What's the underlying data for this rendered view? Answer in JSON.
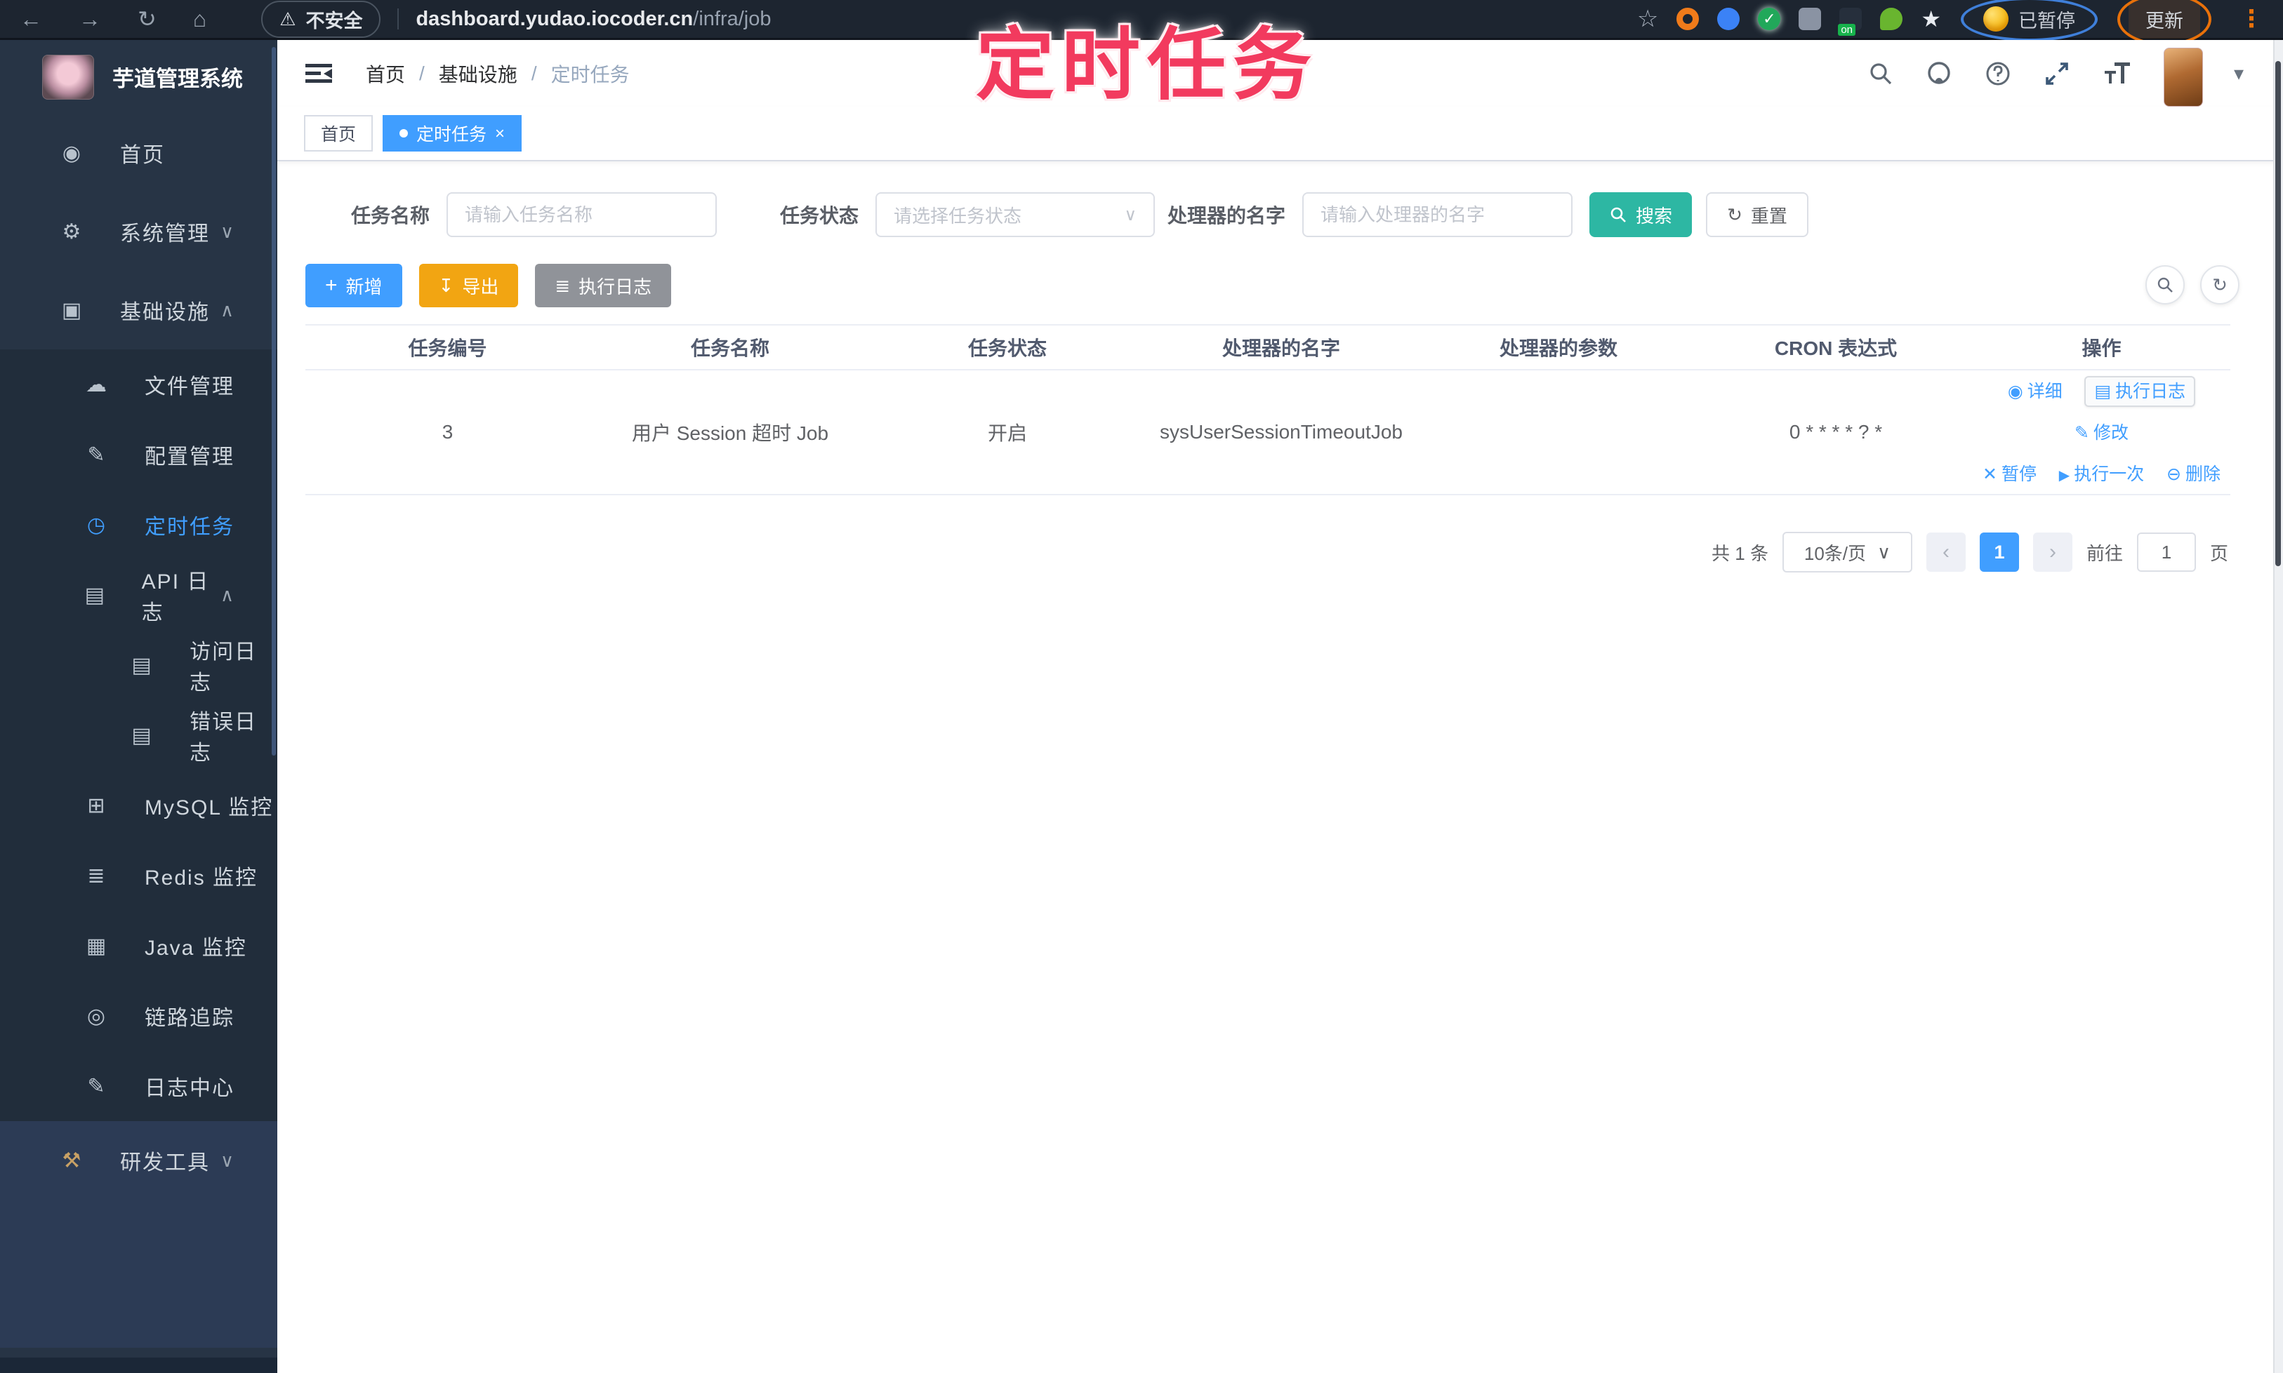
{
  "colors": {
    "accent": "#409EFF",
    "search_teal": "#2db7a3",
    "export_orange": "#f2a512",
    "info_gray": "#909399",
    "overlay_pink": "#f23a5e",
    "sidebar_bg": "#273445"
  },
  "overlay_title": "定时任务",
  "browser": {
    "security_label": "不安全",
    "url_host": "dashboard.yudao.iocoder.cn",
    "url_path": "/infra/job",
    "paused_badge": "已暂停",
    "update_label": "更新"
  },
  "sidebar": {
    "logo_title": "芋道管理系统",
    "items": [
      {
        "label": "首页",
        "icon": "dashboard-icon"
      },
      {
        "label": "系统管理",
        "icon": "gear-icon"
      },
      {
        "label": "基础设施",
        "icon": "monitor-icon"
      },
      {
        "label": "文件管理",
        "icon": "cloud-upload-icon"
      },
      {
        "label": "配置管理",
        "icon": "edit-square-icon"
      },
      {
        "label": "定时任务",
        "icon": "timer-icon"
      },
      {
        "label": "API 日志",
        "icon": "log-icon"
      },
      {
        "label": "访问日志",
        "icon": "document-icon"
      },
      {
        "label": "错误日志",
        "icon": "document-icon"
      },
      {
        "label": "MySQL 监控",
        "icon": "database-grid-icon"
      },
      {
        "label": "Redis 监控",
        "icon": "layers-icon"
      },
      {
        "label": "Java 监控",
        "icon": "java-monitor-icon"
      },
      {
        "label": "链路追踪",
        "icon": "eye-icon"
      },
      {
        "label": "日志中心",
        "icon": "log-edit-icon"
      },
      {
        "label": "研发工具",
        "icon": "briefcase-icon"
      }
    ]
  },
  "header": {
    "breadcrumb": [
      "首页",
      "基础设施",
      "定时任务"
    ]
  },
  "tabs": [
    {
      "label": "首页"
    },
    {
      "label": "定时任务"
    }
  ],
  "filters": {
    "task_name_label": "任务名称",
    "task_name_placeholder": "请输入任务名称",
    "task_status_label": "任务状态",
    "task_status_placeholder": "请选择任务状态",
    "handler_label": "处理器的名字",
    "handler_placeholder": "请输入处理器的名字",
    "search_label": "搜索",
    "reset_label": "重置"
  },
  "toolbar": {
    "add_label": "新增",
    "export_label": "导出",
    "exec_log_label": "执行日志"
  },
  "table": {
    "columns": [
      "任务编号",
      "任务名称",
      "任务状态",
      "处理器的名字",
      "处理器的参数",
      "CRON 表达式",
      "操作"
    ],
    "rows": [
      {
        "id": "3",
        "name": "用户 Session 超时 Job",
        "status": "开启",
        "handler": "sysUserSessionTimeoutJob",
        "param": "",
        "cron": "0 * * * * ? *",
        "actions_row1": [
          "详细",
          "执行日志",
          "修改"
        ],
        "actions_row2": [
          "暂停",
          "执行一次",
          "删除"
        ]
      }
    ]
  },
  "pagination": {
    "total": "共 1 条",
    "page_size": "10条/页",
    "current_page": "1",
    "goto_label": "前往",
    "goto_value": "1",
    "page_unit": "页"
  }
}
